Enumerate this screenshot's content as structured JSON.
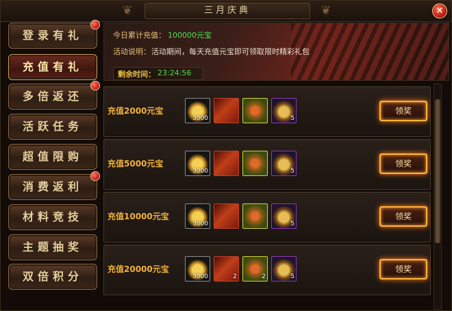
{
  "window": {
    "title": "三月庆典",
    "close_glyph": "×"
  },
  "sidebar": {
    "items": [
      {
        "label": "登录有礼"
      },
      {
        "label": "充值有礼"
      },
      {
        "label": "多倍返还"
      },
      {
        "label": "活跃任务"
      },
      {
        "label": "超值限购"
      },
      {
        "label": "消费返利"
      },
      {
        "label": "材料竞技"
      },
      {
        "label": "主题抽奖"
      },
      {
        "label": "双倍积分"
      }
    ],
    "active_index": 1,
    "notified_indices": [
      0,
      2,
      5
    ]
  },
  "banner": {
    "total_label": "今日累计充值：",
    "total_value": "100000元宝",
    "desc_label": "活动说明：",
    "desc_text": "活动期间，每天充值元宝即可领取限时精彩礼包",
    "time_label": "剩余时间：",
    "time_value": "23:24:56"
  },
  "rewards": [
    {
      "label": "充值2000元宝",
      "items": [
        {
          "icon": "gold-ingot-icon",
          "count": "3000"
        },
        {
          "icon": "scroll-icon",
          "count": ""
        },
        {
          "icon": "fan-icon",
          "count": ""
        },
        {
          "icon": "treasure-bag-icon",
          "count": "5"
        }
      ],
      "button": "领奖"
    },
    {
      "label": "充值5000元宝",
      "items": [
        {
          "icon": "gold-ingot-icon",
          "count": "3000"
        },
        {
          "icon": "scroll-icon",
          "count": ""
        },
        {
          "icon": "fan-icon",
          "count": ""
        },
        {
          "icon": "treasure-bag-icon",
          "count": "5"
        }
      ],
      "button": "领奖"
    },
    {
      "label": "充值10000元宝",
      "items": [
        {
          "icon": "gold-ingot-icon",
          "count": "3000"
        },
        {
          "icon": "scroll-icon",
          "count": ""
        },
        {
          "icon": "fan-icon",
          "count": ""
        },
        {
          "icon": "treasure-bag-icon",
          "count": "5"
        }
      ],
      "button": "领奖"
    },
    {
      "label": "充值20000元宝",
      "items": [
        {
          "icon": "gold-ingot-icon",
          "count": "3000"
        },
        {
          "icon": "scroll-icon",
          "count": "2"
        },
        {
          "icon": "fan-icon",
          "count": "2"
        },
        {
          "icon": "treasure-bag-icon",
          "count": "5"
        }
      ],
      "button": "领奖"
    }
  ],
  "colors": {
    "accent": "#f1b23a",
    "value_green": "#4fe04f",
    "panel": "#1b140f"
  }
}
